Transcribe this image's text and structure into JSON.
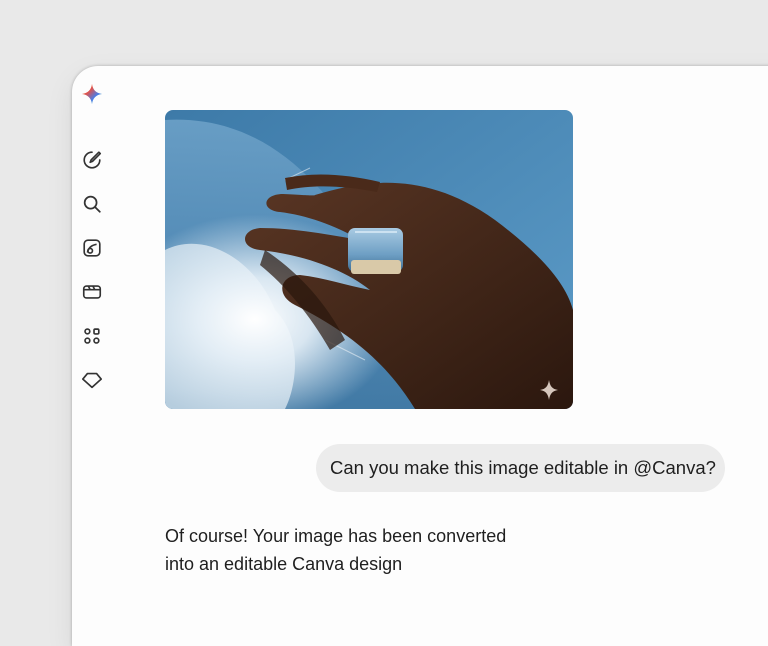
{
  "sidebar": {
    "logo": "gemini-spark-icon",
    "items": [
      {
        "icon": "new-chat-icon"
      },
      {
        "icon": "search-icon"
      },
      {
        "icon": "media-library-icon"
      },
      {
        "icon": "video-icon"
      },
      {
        "icon": "apps-icon"
      },
      {
        "icon": "gem-icon"
      }
    ]
  },
  "conversation": {
    "image_subject": "hand-wearing-square-blue-ring-against-sky",
    "user_message": "Can you make this image editable in @Canva?",
    "assistant_reply_line1": "Of course! Your image has been converted",
    "assistant_reply_line2": "into an editable Canva design"
  },
  "colors": {
    "window_bg": "#fdfdfd",
    "page_bg": "#e9e9e9",
    "bubble_bg": "#ececec",
    "text": "#1f1f1f",
    "sky": "#4f87b3"
  }
}
